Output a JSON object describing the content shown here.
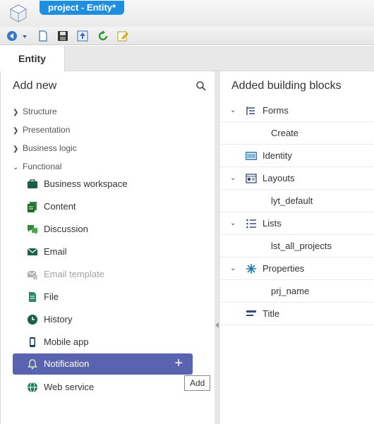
{
  "window": {
    "title": "project - Entity*"
  },
  "toolbar": {
    "buttons": [
      "back-icon",
      "dropdown-icon",
      "new-document-icon",
      "save-icon",
      "export-icon",
      "refresh-icon",
      "edit-icon"
    ]
  },
  "tabs": [
    {
      "label": "Entity"
    }
  ],
  "left_panel": {
    "title": "Add new",
    "categories": [
      {
        "label": "Structure",
        "expanded": false
      },
      {
        "label": "Presentation",
        "expanded": false
      },
      {
        "label": "Business logic",
        "expanded": false
      },
      {
        "label": "Functional",
        "expanded": true
      }
    ],
    "items": [
      {
        "label": "Business workspace",
        "icon": "briefcase-icon",
        "disabled": false
      },
      {
        "label": "Content",
        "icon": "content-icon",
        "disabled": false
      },
      {
        "label": "Discussion",
        "icon": "discussion-icon",
        "disabled": false
      },
      {
        "label": "Email",
        "icon": "email-icon",
        "disabled": false
      },
      {
        "label": "Email template",
        "icon": "email-template-icon",
        "disabled": true
      },
      {
        "label": "File",
        "icon": "file-icon",
        "disabled": false
      },
      {
        "label": "History",
        "icon": "history-icon",
        "disabled": false
      },
      {
        "label": "Mobile app",
        "icon": "mobile-icon",
        "disabled": false
      },
      {
        "label": "Notification",
        "icon": "bell-icon",
        "disabled": false,
        "selected": true,
        "action": "+"
      },
      {
        "label": "Web service",
        "icon": "globe-icon",
        "disabled": false
      }
    ],
    "tooltip": "Add"
  },
  "right_panel": {
    "title": "Added building blocks",
    "rows": [
      {
        "label": "Forms",
        "icon": "forms-icon",
        "expandable": true
      },
      {
        "label": "Create",
        "child": true
      },
      {
        "label": "Identity",
        "icon": "identity-icon",
        "expandable": false
      },
      {
        "label": "Layouts",
        "icon": "layouts-icon",
        "expandable": true
      },
      {
        "label": "lyt_default",
        "child": true
      },
      {
        "label": "Lists",
        "icon": "lists-icon",
        "expandable": true
      },
      {
        "label": "lst_all_projects",
        "child": true
      },
      {
        "label": "Properties",
        "icon": "properties-icon",
        "expandable": true
      },
      {
        "label": "prj_name",
        "child": true
      },
      {
        "label": "Title",
        "icon": "title-icon",
        "expandable": false
      }
    ]
  },
  "colors": {
    "title_tab": "#1e8ee0",
    "selected_item": "#5a63b0",
    "icon_green": "#1a7a4a",
    "icon_blue": "#1a6fb0"
  }
}
